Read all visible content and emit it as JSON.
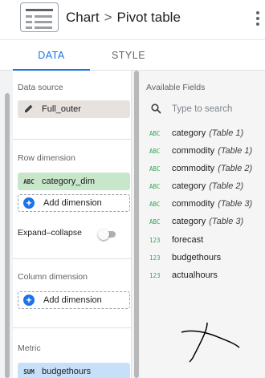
{
  "header": {
    "crumb": "Chart",
    "separator": ">",
    "title": "Pivot table",
    "chart_icon": "pivot-table-icon",
    "more_icon": "more-vert-icon"
  },
  "tabs": [
    {
      "label": "DATA",
      "active": true
    },
    {
      "label": "STYLE",
      "active": false
    }
  ],
  "setup": {
    "data_source": {
      "label": "Data source",
      "value": "Full_outer",
      "icon": "pencil-icon"
    },
    "row_dimension": {
      "label": "Row dimension",
      "chip": {
        "type": "ABC",
        "name": "category_dim"
      },
      "add_label": "Add dimension"
    },
    "expand_collapse": {
      "label": "Expand–collapse",
      "enabled": false
    },
    "column_dimension": {
      "label": "Column dimension",
      "add_label": "Add dimension"
    },
    "metric": {
      "label": "Metric",
      "chip": {
        "type": "SUM",
        "name": "budgethours"
      }
    }
  },
  "available_fields": {
    "title": "Available Fields",
    "search_placeholder": "Type to search",
    "items": [
      {
        "type": "ABC",
        "name": "category",
        "table": "(Table 1)"
      },
      {
        "type": "ABC",
        "name": "commodity",
        "table": "(Table 1)"
      },
      {
        "type": "ABC",
        "name": "commodity",
        "table": "(Table 2)"
      },
      {
        "type": "ABC",
        "name": "category",
        "table": "(Table 2)"
      },
      {
        "type": "ABC",
        "name": "commodity",
        "table": "(Table 3)"
      },
      {
        "type": "ABC",
        "name": "category",
        "table": "(Table 3)"
      },
      {
        "type": "123",
        "name": "forecast",
        "table": ""
      },
      {
        "type": "123",
        "name": "budgethours",
        "table": ""
      },
      {
        "type": "123",
        "name": "actualhours",
        "table": ""
      }
    ]
  },
  "colors": {
    "accent": "#1a73e8",
    "dimension_chip": "#c8e6c9",
    "metric_chip": "#c7e0fa",
    "source_chip": "#e8e2df",
    "field_type": "#34a853"
  }
}
